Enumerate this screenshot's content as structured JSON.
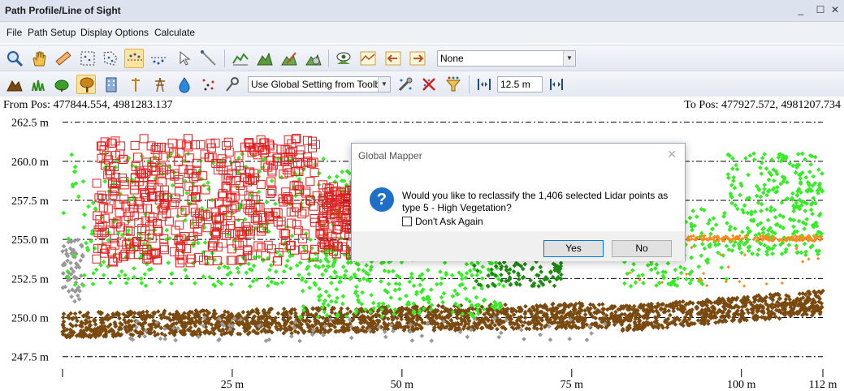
{
  "window": {
    "title": "Path Profile/Line of Sight",
    "minimize": "_",
    "maximize": "☐",
    "close": "✕"
  },
  "menu": [
    "File",
    "Path Setup",
    "Display Options",
    "Calculate"
  ],
  "toolbar1": {
    "combo_value": "None"
  },
  "toolbar2": {
    "class_combo_value": "Use Global Setting from Toolb",
    "spacing_value": "12.5 m"
  },
  "positions": {
    "from": "From Pos: 477844.554, 4981283.137",
    "to": "To Pos: 477927.572, 4981207.734"
  },
  "colors": {
    "ground": "#7a4a10",
    "high_veg": "#33ee22",
    "med_veg": "#1f8a14",
    "unclassified": "#999999",
    "building": "#ff8a1c",
    "selection": "#e02020"
  },
  "chart_data": {
    "type": "scatter",
    "title": "",
    "xlabel": "",
    "ylabel": "",
    "xlim": [
      0,
      112
    ],
    "ylim": [
      246.5,
      263
    ],
    "x_ticks": [
      25,
      50,
      75,
      100,
      112
    ],
    "x_tick_labels": [
      "25 m",
      "50 m",
      "75 m",
      "100 m",
      "112 m"
    ],
    "y_ticks": [
      247.5,
      250.0,
      252.5,
      255.0,
      257.5,
      260.0,
      262.5
    ],
    "y_tick_labels": [
      "247.5 m",
      "250.0 m",
      "252.5 m",
      "255.0 m",
      "257.5 m",
      "260.0 m",
      "262.5 m"
    ],
    "grid": "horizontal dash-dot",
    "series": [
      {
        "class": "ground",
        "x_range": [
          0,
          112
        ],
        "y_range": [
          248.5,
          251.5
        ]
      },
      {
        "class": "high_veg",
        "x_range": [
          0,
          112
        ],
        "y_range": [
          249.5,
          261
        ]
      },
      {
        "class": "med_veg",
        "x_range": [
          60,
          95
        ],
        "y_range": [
          251.5,
          253.5
        ]
      },
      {
        "class": "building",
        "x_range": [
          92,
          112
        ],
        "y_range": [
          254.8,
          255.3
        ]
      },
      {
        "class": "selection",
        "x_range": [
          5,
          45
        ],
        "y_range": [
          253.5,
          261.5
        ]
      }
    ]
  },
  "dialog": {
    "title": "Global Mapper",
    "close": "✕",
    "icon": "?",
    "message": "Would you like to reclassify the 1,406 selected Lidar points as type 5 - High Vegetation?",
    "checkbox_label": "Don't Ask Again",
    "yes_label": "Yes",
    "no_label": "No"
  }
}
